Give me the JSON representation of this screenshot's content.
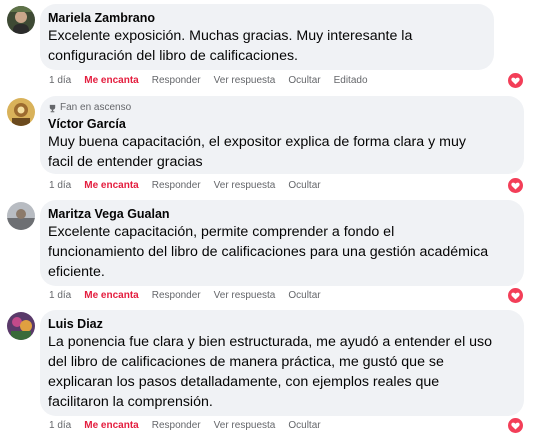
{
  "comments": [
    {
      "author": "Mariela Zambrano",
      "badge": "",
      "lines": [
        "Excelente exposición. Muchas gracias. Muy interesante la",
        "configuración del libro de calificaciones."
      ],
      "time": "1 día",
      "like": "Me encanta",
      "reply": "Responder",
      "view_reply": "Ver respuesta",
      "hide": "Ocultar",
      "edited": "Editado",
      "reaction_icon": "love-reaction-icon",
      "avatar_color": "#4a5a3c"
    },
    {
      "author": "Víctor García",
      "badge": "Fan en ascenso",
      "lines": [
        "Muy buena capacitación, el expositor explica de forma clara y muy",
        "facil de entender gracias"
      ],
      "time": "1 día",
      "like": "Me encanta",
      "reply": "Responder",
      "view_reply": "Ver respuesta",
      "hide": "Ocultar",
      "edited": "",
      "reaction_icon": "love-reaction-icon",
      "avatar_color": "#c49a3a"
    },
    {
      "author": "Maritza Vega Gualan",
      "badge": "",
      "lines": [
        "Excelente capacitación, permite comprender a fondo el",
        "funcionamiento del libro de calificaciones para una gestión académica",
        "eficiente."
      ],
      "time": "1 día",
      "like": "Me encanta",
      "reply": "Responder",
      "view_reply": "Ver respuesta",
      "hide": "Ocultar",
      "edited": "",
      "reaction_icon": "love-reaction-icon",
      "avatar_color": "#8a8c90"
    },
    {
      "author": "Luis Diaz",
      "badge": "",
      "lines": [
        "La ponencia fue clara y bien estructurada, me ayudó a entender el uso",
        "del libro de calificaciones de manera práctica, me gustó que se",
        "explicaran los pasos detalladamente, con ejemplos reales que",
        "facilitaron la comprensión."
      ],
      "time": "1 día",
      "like": "Me encanta",
      "reply": "Responder",
      "view_reply": "Ver respuesta",
      "hide": "Ocultar",
      "edited": "",
      "reaction_icon": "love-reaction-icon",
      "avatar_color": "#7a4b8a"
    }
  ],
  "colors": {
    "bubble": "#f0f2f5",
    "like_active": "#e41e3f",
    "meta_text": "#65676b",
    "heart": "#f33e58"
  }
}
